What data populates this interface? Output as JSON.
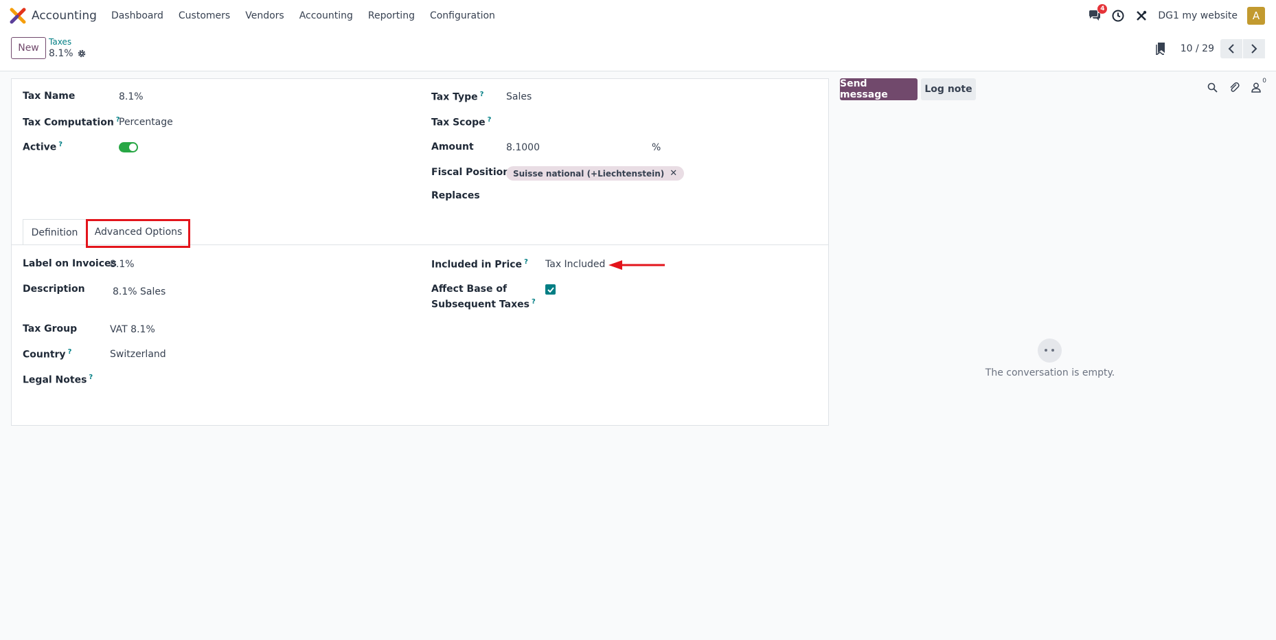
{
  "navbar": {
    "app_name": "Accounting",
    "menu": [
      "Dashboard",
      "Customers",
      "Vendors",
      "Accounting",
      "Reporting",
      "Configuration"
    ],
    "messages_badge": "4",
    "company": "DG1 my website",
    "avatar_letter": "A"
  },
  "control_panel": {
    "new_label": "New",
    "breadcrumb_parent": "Taxes",
    "breadcrumb_current": "8.1%",
    "pager": "10 / 29"
  },
  "form": {
    "tax_name_label": "Tax Name",
    "tax_name_value": "8.1%",
    "tax_computation_label": "Tax Computation",
    "tax_computation_value": "Percentage",
    "active_label": "Active",
    "active_value": true,
    "tax_type_label": "Tax Type",
    "tax_type_value": "Sales",
    "tax_scope_label": "Tax Scope",
    "amount_label": "Amount",
    "amount_value": "8.1000",
    "amount_unit": "%",
    "fiscal_position_label": "Fiscal Position",
    "fiscal_position_tag": "Suisse national (+Liechtenstein)",
    "replaces_label": "Replaces"
  },
  "tabs": {
    "definition": "Definition",
    "advanced": "Advanced Options"
  },
  "advanced": {
    "label_on_invoices_label": "Label on Invoices",
    "label_on_invoices_value": "8.1%",
    "description_label": "Description",
    "description_value": "8.1% Sales",
    "tax_group_label": "Tax Group",
    "tax_group_value": "VAT 8.1%",
    "country_label": "Country",
    "country_value": "Switzerland",
    "legal_notes_label": "Legal Notes",
    "included_in_price_label": "Included in Price",
    "included_in_price_value": "Tax Included",
    "affect_base_label_1": "Affect Base of",
    "affect_base_label_2": "Subsequent Taxes",
    "affect_base_value": true
  },
  "chatter": {
    "send_message": "Send message",
    "log_note": "Log note",
    "followers_count": "0",
    "empty_text": "The conversation is empty."
  },
  "help_mark": "?",
  "colors": {
    "primary": "#71496c",
    "link": "#017e84",
    "toggle_on": "#28a745",
    "highlight": "#e3141b"
  }
}
